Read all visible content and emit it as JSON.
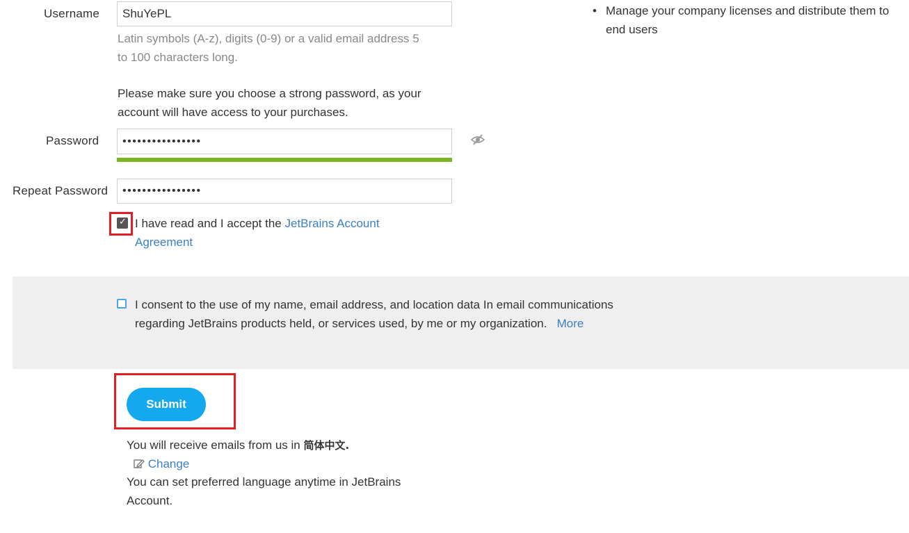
{
  "username": {
    "label": "Username",
    "value": "ShuYePL",
    "hint": "Latin symbols (A-z), digits (0-9) or a valid email address 5 to 100 characters long."
  },
  "password_notice": "Please make sure you choose a strong password, as your account will have access to your purchases.",
  "password": {
    "label": "Password",
    "value": "••••••••••••••••",
    "strength": 1.0,
    "strength_color": "#7cb526",
    "toggle_icon": "eye-slash-icon"
  },
  "repeat_password": {
    "label": "Repeat Password",
    "value": "••••••••••••••••"
  },
  "agreement": {
    "checked": true,
    "text": "I have read and I accept the ",
    "link_line1": "JetBrains Account",
    "link_line2": "Agreement"
  },
  "consent": {
    "checked": false,
    "text": "I consent to the use of my name, email address, and location data In email communications regarding JetBrains products held, or services used, by me or my organization.",
    "more_link": "More"
  },
  "submit": {
    "label": "Submit",
    "color": "#14a8ef"
  },
  "language": {
    "prefix": "You will receive emails from us in ",
    "value": "简体中文.",
    "change_label": "Change",
    "change_icon": "edit-icon",
    "note": "You can set preferred language anytime in JetBrains Account."
  },
  "benefits": [
    "Manage your company licenses and distribute them to end users"
  ],
  "colors": {
    "link": "#3c7fc1",
    "highlight": "#e21f26",
    "consent_background": "#efefef"
  }
}
